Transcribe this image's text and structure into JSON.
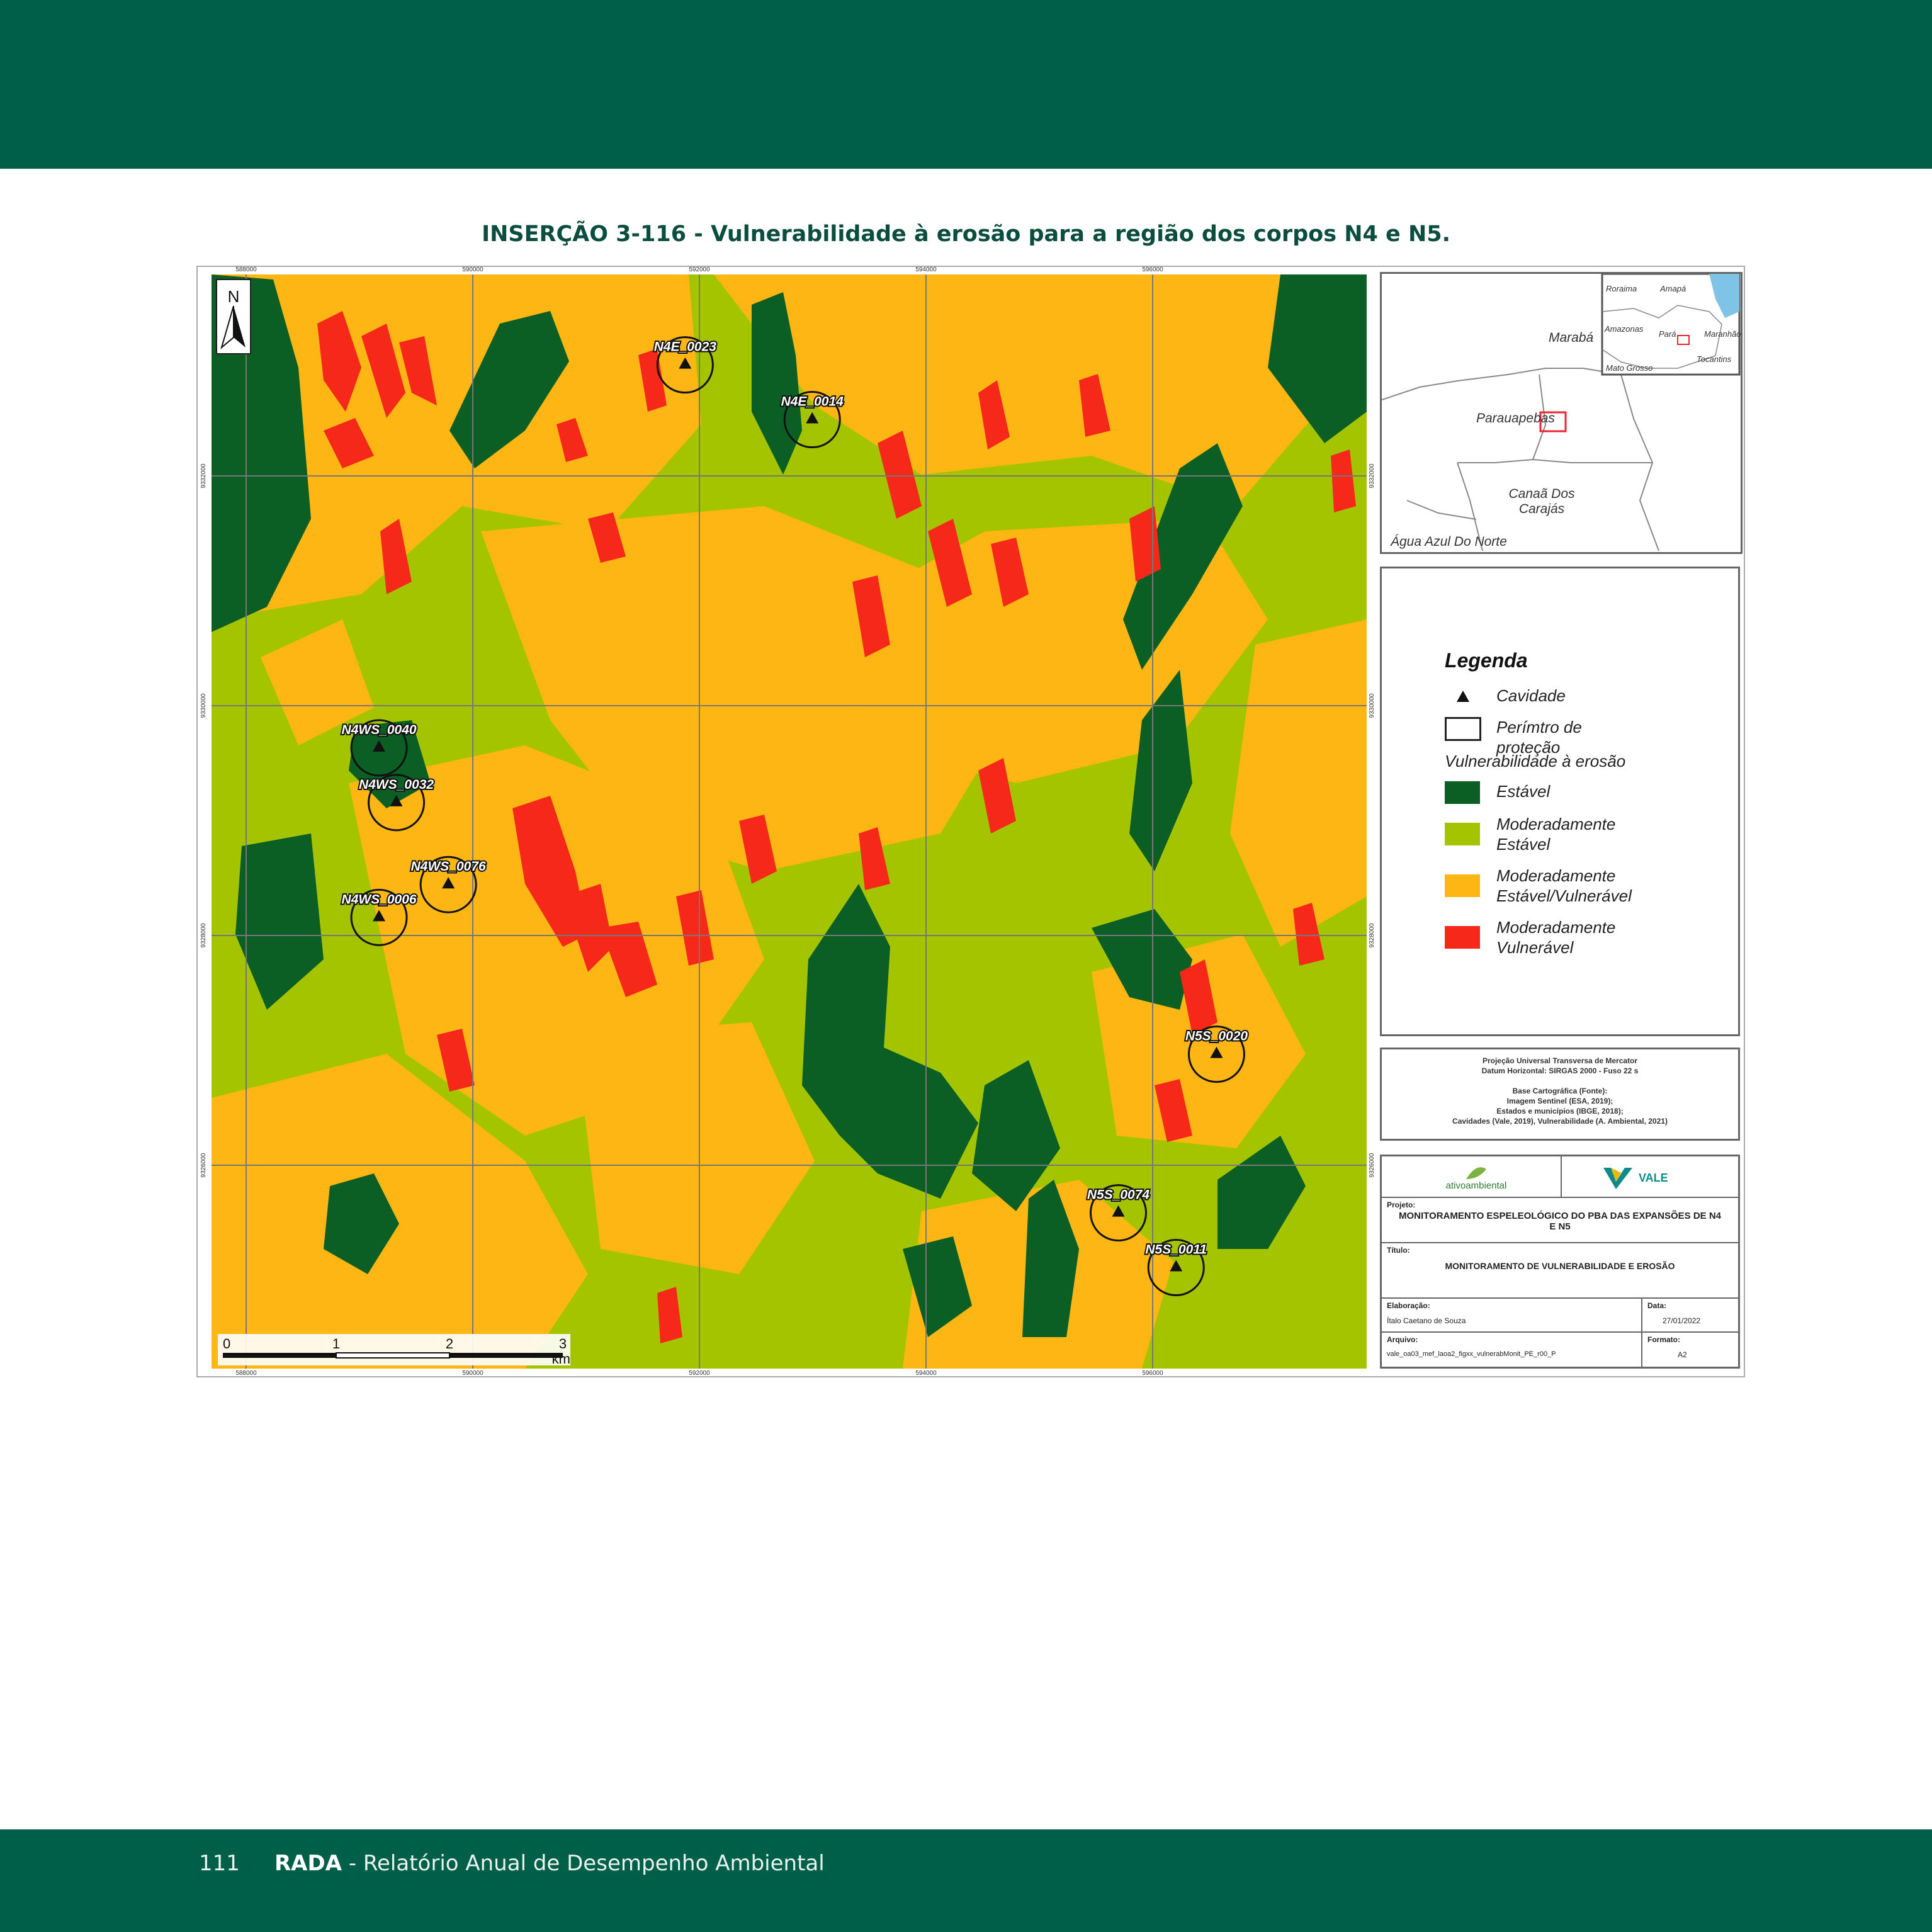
{
  "figure": {
    "title": "INSERÇÃO 3-116 - Vulnerabilidade à erosão para a região dos corpos N4 e N5."
  },
  "footer": {
    "page_number": "111",
    "brand": "RADA",
    "subtitle": " - Relatório Anual de Desempenho Ambiental"
  },
  "map": {
    "north_label": "N",
    "x_ticks": [
      "588000",
      "590000",
      "592000",
      "594000",
      "596000"
    ],
    "y_ticks": [
      "9332000",
      "9330000",
      "9328000",
      "9326000"
    ],
    "scale_labels": [
      "0",
      "1",
      "2",
      "3"
    ],
    "scale_unit": "km",
    "caves": [
      {
        "label": "N4E_0023",
        "x": 0.41,
        "y": 0.07
      },
      {
        "label": "N4E_0014",
        "x": 0.52,
        "y": 0.12
      },
      {
        "label": "N4WS_0040",
        "x": 0.145,
        "y": 0.42
      },
      {
        "label": "N4WS_0032",
        "x": 0.16,
        "y": 0.47
      },
      {
        "label": "N4WS_0076",
        "x": 0.205,
        "y": 0.545
      },
      {
        "label": "N4WS_0006",
        "x": 0.145,
        "y": 0.575
      },
      {
        "label": "N5S_0020",
        "x": 0.87,
        "y": 0.7
      },
      {
        "label": "N5S_0074",
        "x": 0.785,
        "y": 0.845
      },
      {
        "label": "N5S_0011",
        "x": 0.835,
        "y": 0.895
      }
    ],
    "colors": {
      "estavel": "#0b5e24",
      "moderadamente_estavel": "#a4c400",
      "mod_estavel_vulneravel": "#fdb613",
      "moderadamente_vulneravel": "#f5281a"
    }
  },
  "inset": {
    "places": [
      "Marabá",
      "Parauapebas",
      "Canaã Dos Carajás",
      "Água Azul Do Norte"
    ],
    "mini_places": [
      "Roraima",
      "Amapá",
      "Amazonas",
      "Pará",
      "Maranhão",
      "Mato Grosso",
      "Tocantins"
    ]
  },
  "legend": {
    "title": "Legenda",
    "cave_label": "Cavidade",
    "perimeter_label": "Perímtro de proteção",
    "section_label": "Vulnerabilidade à erosão",
    "classes": [
      {
        "label": "Estável",
        "color": "#0b5e24"
      },
      {
        "label": "Moderadamente Estável",
        "color": "#a4c400"
      },
      {
        "label": "Moderadamente Estável/Vulnerável",
        "color": "#fdb613"
      },
      {
        "label": "Moderadamente Vulnerável",
        "color": "#f5281a"
      }
    ]
  },
  "technical": {
    "lines": [
      "Projeção Universal Transversa de Mercator",
      "Datum Horizontal: SIRGAS 2000 - Fuso 22 s",
      "Base Cartográfica (Fonte):",
      "Imagem Sentinel (ESA, 2019);",
      "Estados e municípios (IBGE, 2018);",
      "Cavidades (Vale, 2019), Vulnerabilidade (A. Ambiental, 2021)"
    ]
  },
  "title_block": {
    "logo_left": "ativoambiental",
    "logo_right": "VALE",
    "project_label": "Projeto:",
    "project": "MONITORAMENTO ESPELEOLÓGICO DO PBA DAS EXPANSÕES DE N4 E N5",
    "title_label": "Título:",
    "title": "MONITORAMENTO DE VULNERABILIDADE E EROSÃO",
    "elab_label": "Elaboração:",
    "elab": "Ítalo Caetano de Souza",
    "date_label": "Data:",
    "date": "27/01/2022",
    "file_label": "Arquivo:",
    "file": "vale_oa03_mef_laoa2_figxx_vulnerabMonit_PE_r00_P",
    "format_label": "Formato:",
    "format": "A2"
  }
}
